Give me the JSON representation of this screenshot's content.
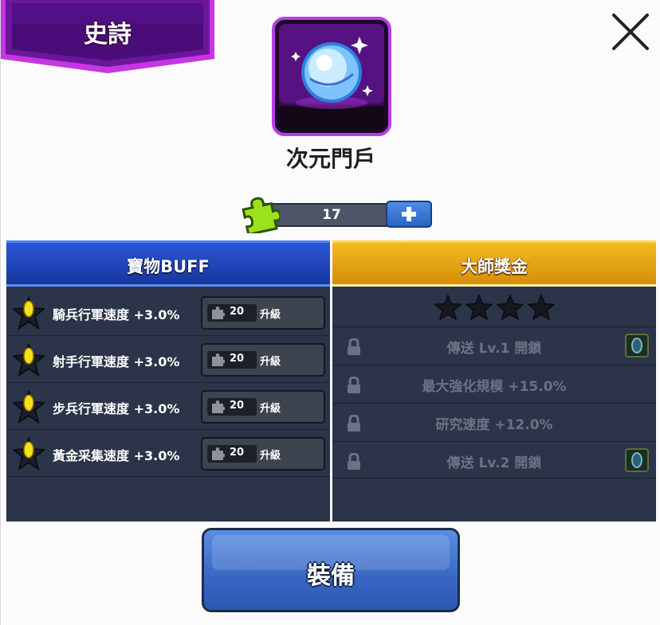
{
  "rarity": {
    "label": "史詩",
    "color": "#8a1fc2"
  },
  "item": {
    "name": "次元門戶",
    "icon": "crystal-orb-icon"
  },
  "fragments": {
    "count": "17",
    "plus_icon": "plus-icon"
  },
  "treasure_buff": {
    "title": "寶物BUFF",
    "rows": [
      {
        "text": "騎兵行軍速度 +3.0%",
        "cost": "20",
        "button": "升級"
      },
      {
        "text": "射手行軍速度 +3.0%",
        "cost": "20",
        "button": "升級"
      },
      {
        "text": "步兵行軍速度 +3.0%",
        "cost": "20",
        "button": "升級"
      },
      {
        "text": "黃金采集速度 +3.0%",
        "cost": "20",
        "button": "升級"
      }
    ]
  },
  "master_bonus": {
    "title": "大師獎金",
    "stars_total": 4,
    "stars_filled": 0,
    "rows": [
      {
        "text": "傳送 Lv.1 開鎖",
        "has_portal_icon": true
      },
      {
        "text": "最大強化規模 +15.0%",
        "has_portal_icon": false
      },
      {
        "text": "研究速度 +12.0%",
        "has_portal_icon": false
      },
      {
        "text": "傳送 Lv.2 開鎖",
        "has_portal_icon": true
      }
    ]
  },
  "equip_button": {
    "label": "裝備"
  }
}
